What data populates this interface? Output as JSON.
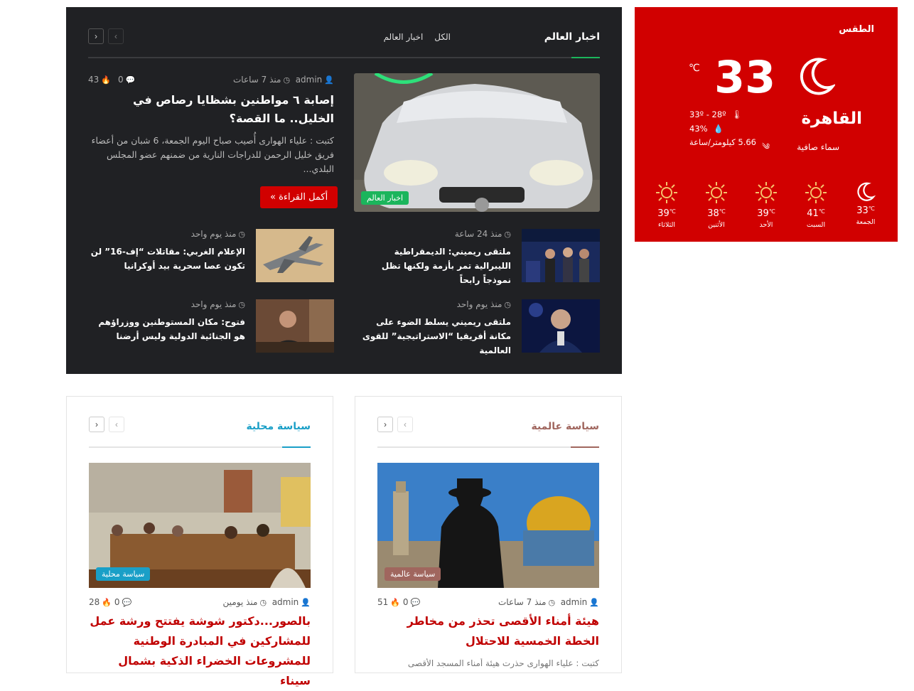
{
  "world_news": {
    "title": "اخبار العالم",
    "tabs": [
      "الكل",
      "اخبار العالم"
    ],
    "prev_icon": "‹",
    "next_icon": "›",
    "featured": {
      "category": "اخبار العالم",
      "author": "admin",
      "time": "منذ 7 ساعات",
      "comments": "0",
      "views": "43",
      "title": "إصابة ٦ مواطنين بشظايا رصاص في الخليل.. ما القصة؟",
      "excerpt": "كتبت : علياء الهوارى أُصيب صباح اليوم الجمعة، 6 شبان من أعضاء فريق خليل الرحمن للدراجات النارية من ضمنهم عضو المجلس البلدي...",
      "read_more": "أكمل القراءة »"
    },
    "items": [
      {
        "time": "منذ 24 ساعة",
        "title": "ملتقى ريميني: الديمقراطية الليبرالية تمر بأزمة ولكنها تظل نموذجاً رابحاً"
      },
      {
        "time": "منذ يوم واحد",
        "title": "الإعلام الغربي: مقاتلات “إف-16” لن تكون عصا سحرية بيد أوكرانيا"
      },
      {
        "time": "منذ يوم واحد",
        "title": "ملتقى ريميني يسلط الضوء على مكانة أفريقيا “الاستراتيجية” للقوى العالمية"
      },
      {
        "time": "منذ يوم واحد",
        "title": "فتوح: مكان المستوطنين ووزراؤهم هو الجنائية الدولية وليس أرضنا"
      }
    ]
  },
  "weather": {
    "title": "الطقس",
    "temp": "33",
    "unit": "℃",
    "city": "القاهرة",
    "description": "سماء صافية",
    "range": "33º - 28º",
    "humidity": "43%",
    "wind": "5.66 كيلومتر/ساعة",
    "forecast": [
      {
        "day": "الجمعة",
        "temp": "33",
        "unit": "℃",
        "icon": "moon-icon"
      },
      {
        "day": "السبت",
        "temp": "41",
        "unit": "℃",
        "icon": "sun-icon"
      },
      {
        "day": "الأحد",
        "temp": "39",
        "unit": "℃",
        "icon": "sun-icon"
      },
      {
        "day": "الأثنين",
        "temp": "38",
        "unit": "℃",
        "icon": "sun-icon"
      },
      {
        "day": "الثلاثاء",
        "temp": "39",
        "unit": "℃",
        "icon": "sun-icon"
      }
    ]
  },
  "world_politics": {
    "title": "سياسة عالمية",
    "badge": "سياسة عالمية",
    "color": "#a0665e",
    "author": "admin",
    "time": "منذ 7 ساعات",
    "comments": "0",
    "views": "51",
    "headline": "هيئة أمناء الأقصى تحذر من مخاطر الخطة الخمسية للاحتلال",
    "excerpt": "كتبت : علياء الهوارى حذرت هيئة أمناء المسجد الأقصى"
  },
  "local_politics": {
    "title": "سياسة محلية",
    "badge": "سياسة محلية",
    "color": "#1a9fc7",
    "author": "admin",
    "time": "منذ يومين",
    "comments": "0",
    "views": "28",
    "headline": "بالصور...دكتور شوشة يفتتح ورشة عمل للمشاركين في المبادرة الوطنية للمشروعات الخضراء الذكية بشمال سيناء"
  }
}
